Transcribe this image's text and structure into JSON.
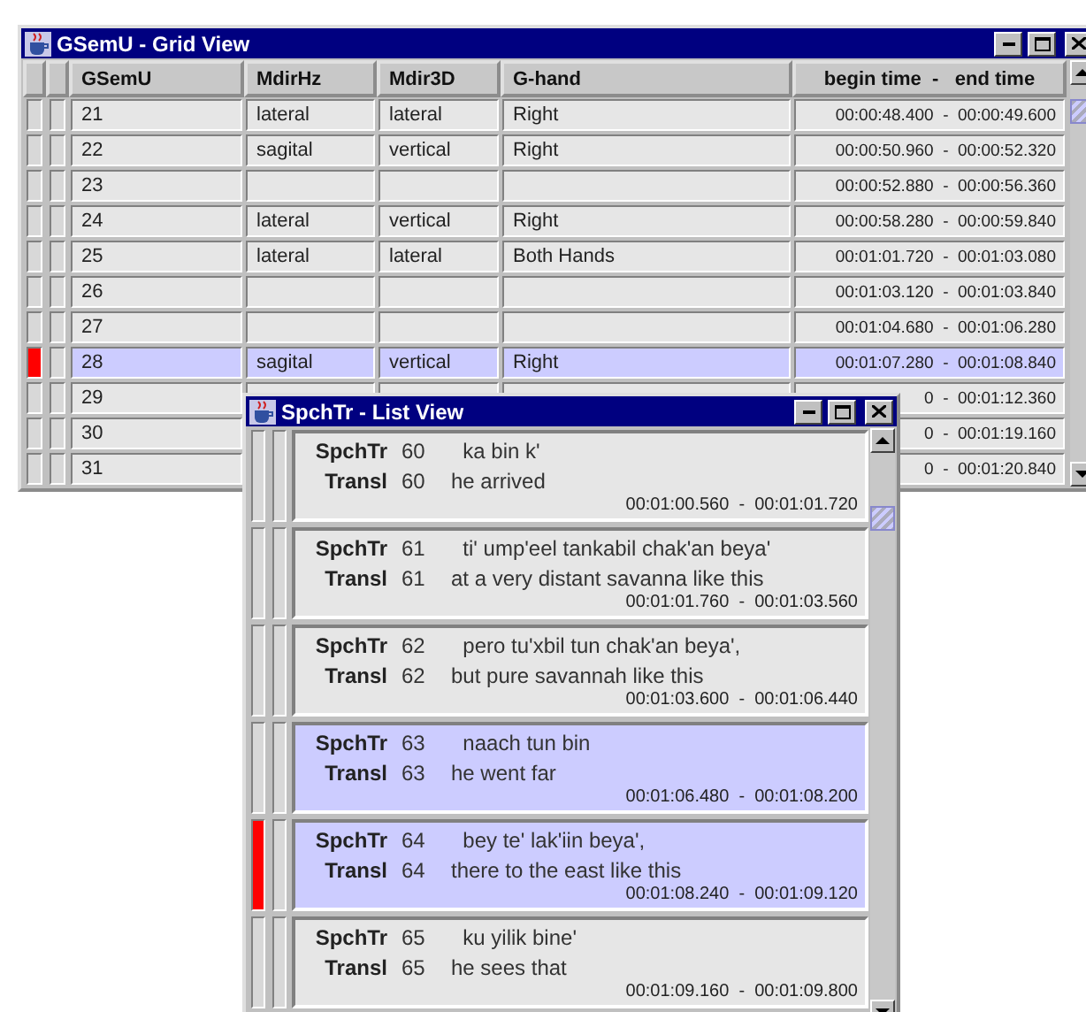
{
  "grid_window": {
    "title": "GSemU - Grid View",
    "columns": [
      "GSemU",
      "MdirHz",
      "Mdir3D",
      "G-hand",
      "begin time  -   end time"
    ],
    "rows": [
      {
        "selected": false,
        "marked": false,
        "cells": [
          "21",
          "lateral",
          "lateral",
          "Right",
          "00:00:48.400  -  00:00:49.600"
        ]
      },
      {
        "selected": false,
        "marked": false,
        "cells": [
          "22",
          "sagital",
          "vertical",
          "Right",
          "00:00:50.960  -  00:00:52.320"
        ]
      },
      {
        "selected": false,
        "marked": false,
        "cells": [
          "23",
          "",
          "",
          "",
          "00:00:52.880  -  00:00:56.360"
        ]
      },
      {
        "selected": false,
        "marked": false,
        "cells": [
          "24",
          "lateral",
          "vertical",
          "Right",
          "00:00:58.280  -  00:00:59.840"
        ]
      },
      {
        "selected": false,
        "marked": false,
        "cells": [
          "25",
          "lateral",
          "lateral",
          "Both Hands",
          "00:01:01.720  -  00:01:03.080"
        ]
      },
      {
        "selected": false,
        "marked": false,
        "cells": [
          "26",
          "",
          "",
          "",
          "00:01:03.120  -  00:01:03.840"
        ]
      },
      {
        "selected": false,
        "marked": false,
        "cells": [
          "27",
          "",
          "",
          "",
          "00:01:04.680  -  00:01:06.280"
        ]
      },
      {
        "selected": true,
        "marked": true,
        "cells": [
          "28",
          "sagital",
          "vertical",
          "Right",
          "00:01:07.280  -  00:01:08.840"
        ]
      },
      {
        "selected": false,
        "marked": false,
        "cells": [
          "29",
          null,
          null,
          null,
          "0  -  00:01:12.360"
        ]
      },
      {
        "selected": false,
        "marked": false,
        "cells": [
          "30",
          null,
          null,
          null,
          "0  -  00:01:19.160"
        ]
      },
      {
        "selected": false,
        "marked": false,
        "cells": [
          "31",
          null,
          null,
          null,
          "0  -  00:01:20.840"
        ]
      }
    ]
  },
  "list_window": {
    "title": "SpchTr - List View",
    "entries": [
      {
        "selected": false,
        "marked": false,
        "lines": [
          {
            "tier": "SpchTr",
            "number": "60",
            "text": "  ka bin k'"
          },
          {
            "tier": "Transl",
            "number": "60",
            "text": "he arrived"
          }
        ],
        "time": "00:01:00.560  -  00:01:01.720"
      },
      {
        "selected": false,
        "marked": false,
        "lines": [
          {
            "tier": "SpchTr",
            "number": "61",
            "text": "  ti' ump'eel tankabil chak'an beya'"
          },
          {
            "tier": "Transl",
            "number": "61",
            "text": "at a very distant savanna like this"
          }
        ],
        "time": "00:01:01.760  -  00:01:03.560"
      },
      {
        "selected": false,
        "marked": false,
        "lines": [
          {
            "tier": "SpchTr",
            "number": "62",
            "text": "  pero tu'xbil tun chak'an beya',"
          },
          {
            "tier": "Transl",
            "number": "62",
            "text": "but pure savannah like this"
          }
        ],
        "time": "00:01:03.600  -  00:01:06.440"
      },
      {
        "selected": true,
        "marked": false,
        "lines": [
          {
            "tier": "SpchTr",
            "number": "63",
            "text": "  naach tun bin"
          },
          {
            "tier": "Transl",
            "number": "63",
            "text": "he went far"
          }
        ],
        "time": "00:01:06.480  -  00:01:08.200"
      },
      {
        "selected": true,
        "marked": true,
        "lines": [
          {
            "tier": "SpchTr",
            "number": "64",
            "text": "  bey te' lak'iin beya',"
          },
          {
            "tier": "Transl",
            "number": "64",
            "text": "there to the east like this"
          }
        ],
        "time": "00:01:08.240  -  00:01:09.120"
      },
      {
        "selected": false,
        "marked": false,
        "lines": [
          {
            "tier": "SpchTr",
            "number": "65",
            "text": "  ku yilik bine'"
          },
          {
            "tier": "Transl",
            "number": "65",
            "text": "he sees that"
          }
        ],
        "time": "00:01:09.160  -  00:01:09.800"
      }
    ]
  }
}
